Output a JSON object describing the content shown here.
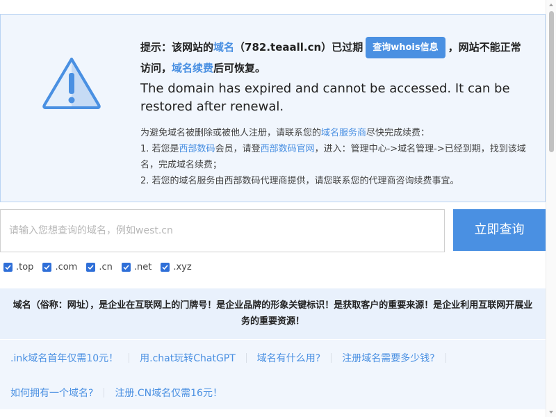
{
  "notice": {
    "line1_prefix": "提示：该网站的",
    "line1_domain_word": "域名",
    "line1_domain": "（782.teaall.cn）",
    "line1_expired": "已过期",
    "whois_button": "查询whois信息",
    "line1_suffix": "，网站不能正常",
    "line2_prefix": "访问，",
    "line2_link": "域名续费",
    "line2_suffix": "后可恢复。",
    "english": "The domain has expired and cannot be accessed. It can be restored after renewal.",
    "intro_prefix": "为避免域名被删除或被他人注册，请联系您的",
    "intro_link": "域名服务商",
    "intro_suffix": "尽快完成续费：",
    "step1_prefix": "1. 若您是",
    "step1_link1": "西部数码",
    "step1_middle": "会员，请登",
    "step1_link2": "西部数码官网",
    "step1_suffix": "，进入：管理中心->域名管理->已经到期，找到该域名，完成域名续费；",
    "step2": "2. 若您的域名服务由西部数码代理商提供，请您联系您的代理商咨询续费事宜。"
  },
  "search": {
    "placeholder": "请输入您想查询的域名，例如west.cn",
    "value": "",
    "button_label": "立即查询"
  },
  "suffixes": [
    {
      "label": ".top",
      "checked": true
    },
    {
      "label": ".com",
      "checked": true
    },
    {
      "label": ".cn",
      "checked": true
    },
    {
      "label": ".net",
      "checked": true
    },
    {
      "label": ".xyz",
      "checked": true
    }
  ],
  "slogan": "域名（俗称：网址），是企业在互联网上的门牌号！是企业品牌的形象关键标识！是获取客户的重要来源！是企业利用互联网开展业务的重要资源！",
  "links": {
    "row1": [
      ".ink域名首年仅需10元！",
      "用.chat玩转ChatGPT",
      "域名有什么用?",
      "注册域名需要多少钱?"
    ],
    "row2": [
      "如何拥有一个域名?",
      "注册.CN域名仅需16元！"
    ]
  },
  "colors": {
    "accent": "#4a90e2",
    "notice_bg": "#f1f6fd",
    "notice_border": "#b9d3f3",
    "checkbox": "#2f6fd8"
  },
  "icons": {
    "warning": "warning-triangle-icon",
    "check": "checkmark-icon"
  }
}
